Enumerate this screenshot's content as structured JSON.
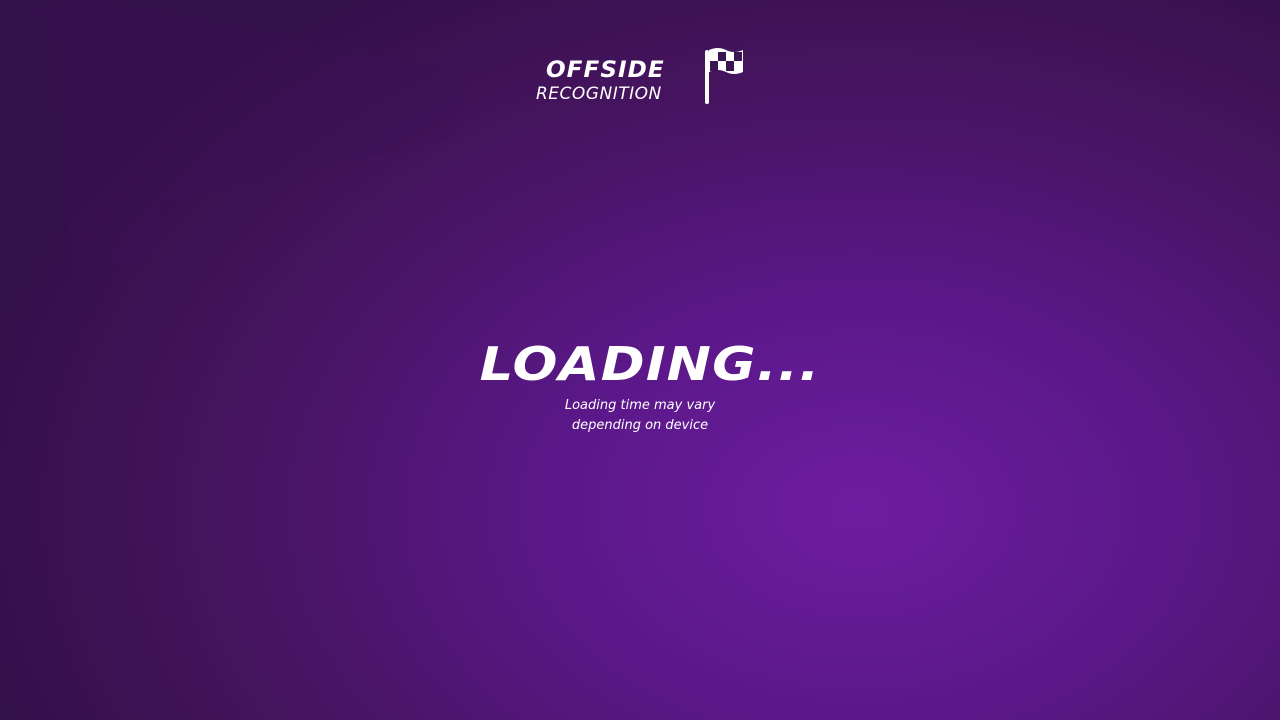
{
  "logo": {
    "line1": "OFFSIDE",
    "line2": "RECOGNITION",
    "icon": "checkered-flag-icon"
  },
  "loading": {
    "title": "LOADING...",
    "subtitle_line1": "Loading time may vary",
    "subtitle_line2": "depending on device"
  },
  "colors": {
    "background_center": "#6f1da0",
    "background_edge": "#34104a",
    "text": "#ffffff"
  }
}
